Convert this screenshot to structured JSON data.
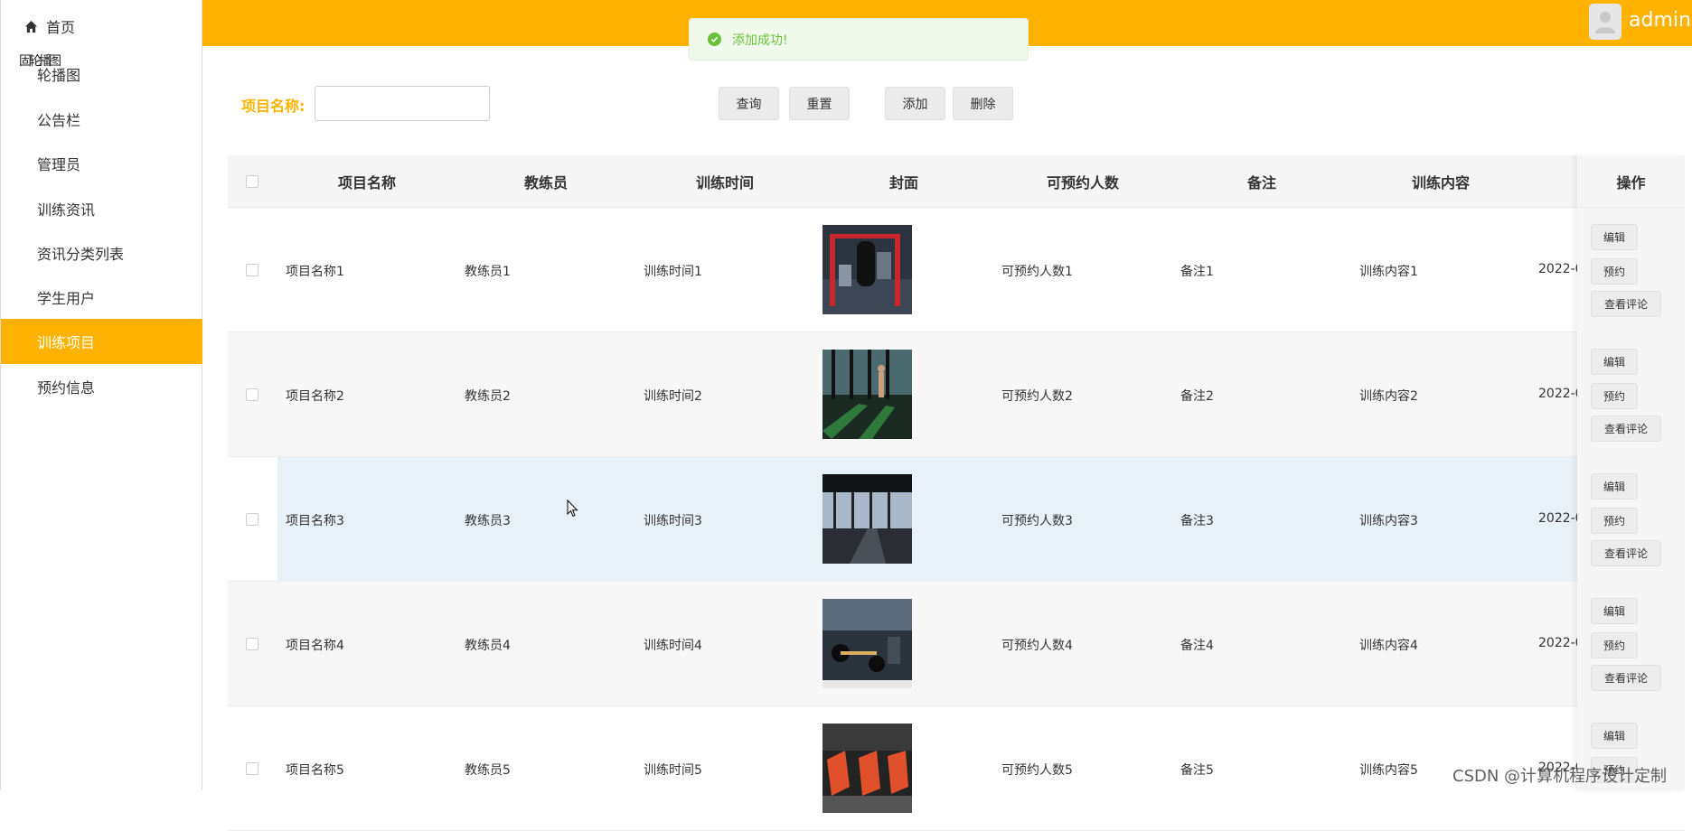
{
  "sidebar": {
    "home": "首页",
    "overlap": "固轮播图",
    "items": [
      "轮播图",
      "公告栏",
      "管理员",
      "训练资讯",
      "资讯分类列表",
      "学生用户",
      "训练项目",
      "预约信息"
    ]
  },
  "header": {
    "username": "admin"
  },
  "toast": {
    "message": "添加成功!"
  },
  "search": {
    "label": "项目名称:",
    "value": ""
  },
  "buttons": {
    "query": "查询",
    "reset": "重置",
    "add": "添加",
    "delete": "删除"
  },
  "table": {
    "columns": [
      "项目名称",
      "教练员",
      "训练时间",
      "封面",
      "可预约人数",
      "备注",
      "训练内容",
      "操作"
    ],
    "rows": [
      {
        "name": "项目名称1",
        "coach": "教练员1",
        "time": "训练时间1",
        "capacity": "可预约人数1",
        "note": "备注1",
        "content": "训练内容1",
        "date": "2022-0"
      },
      {
        "name": "项目名称2",
        "coach": "教练员2",
        "time": "训练时间2",
        "capacity": "可预约人数2",
        "note": "备注2",
        "content": "训练内容2",
        "date": "2022-0"
      },
      {
        "name": "项目名称3",
        "coach": "教练员3",
        "time": "训练时间3",
        "capacity": "可预约人数3",
        "note": "备注3",
        "content": "训练内容3",
        "date": "2022-0"
      },
      {
        "name": "项目名称4",
        "coach": "教练员4",
        "time": "训练时间4",
        "capacity": "可预约人数4",
        "note": "备注4",
        "content": "训练内容4",
        "date": "2022-0"
      },
      {
        "name": "项目名称5",
        "coach": "教练员5",
        "time": "训练时间5",
        "capacity": "可预约人数5",
        "note": "备注5",
        "content": "训练内容5",
        "date": "2022-0"
      }
    ],
    "row_actions": {
      "edit": "编辑",
      "book": "预约",
      "comments": "查看评论"
    }
  },
  "watermark": "CSDN @计算机程序设计定制",
  "colors": {
    "accent": "#FFB300",
    "success": "#67c23a"
  }
}
